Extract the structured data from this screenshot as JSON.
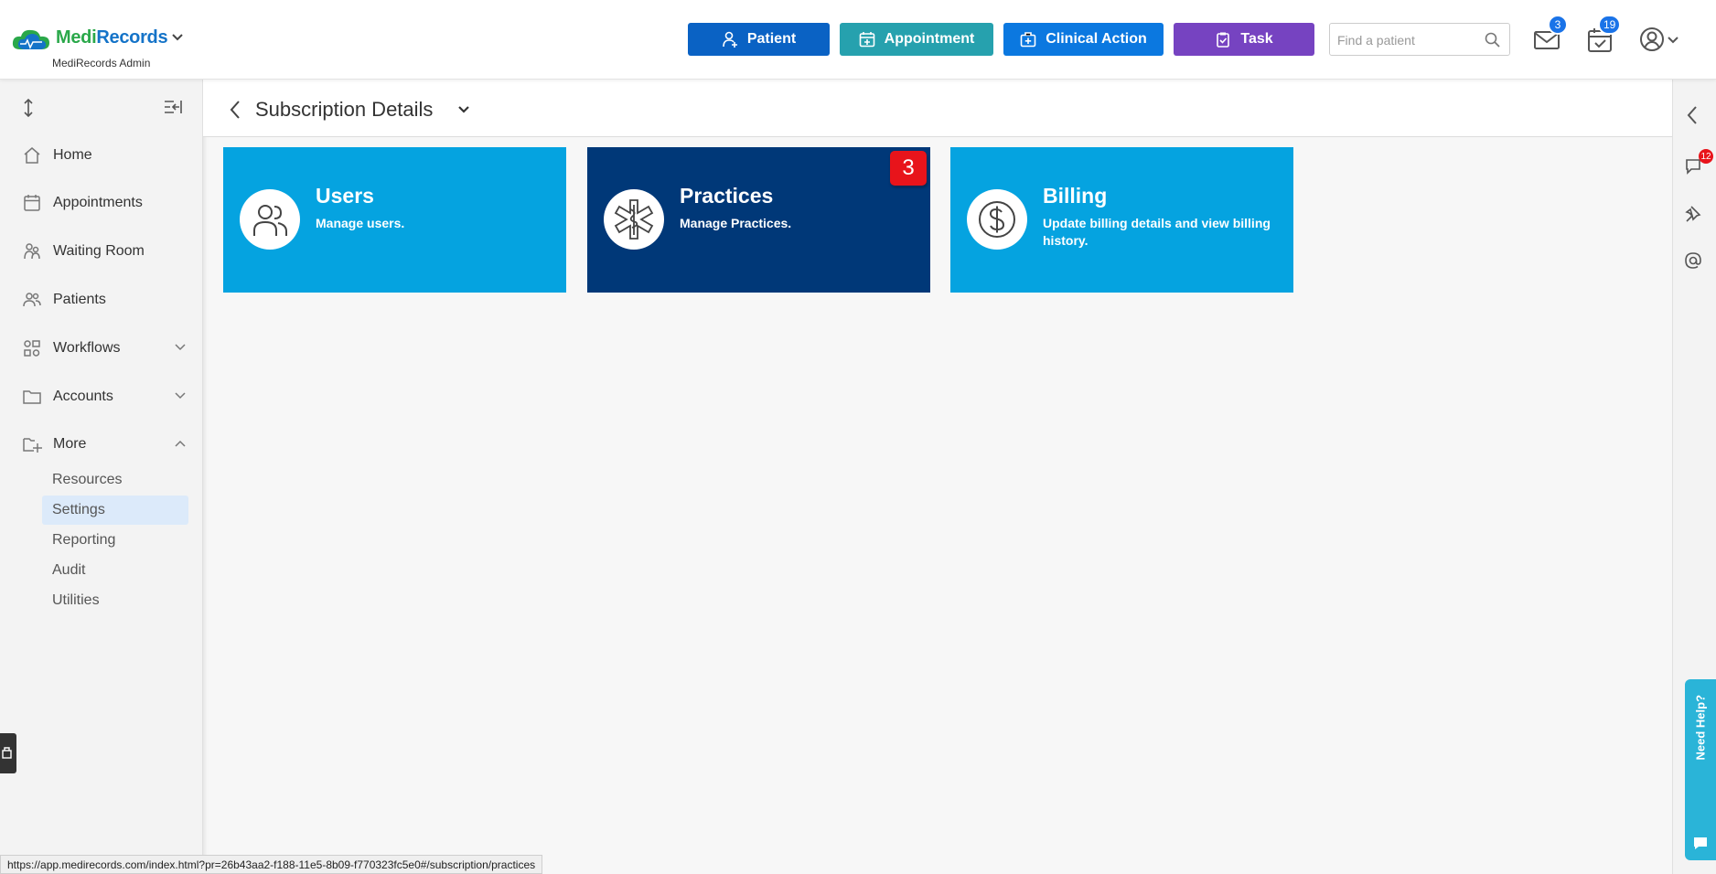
{
  "header": {
    "logo": {
      "part1": "Medi",
      "part2": "Records",
      "subtitle": "MediRecords Admin"
    },
    "buttons": [
      {
        "label": "Patient",
        "color": "#0a62c4",
        "icon": "add-person-icon"
      },
      {
        "label": "Appointment",
        "color": "#26a1ae",
        "icon": "calendar-plus-icon"
      },
      {
        "label": "Clinical Action",
        "color": "#0b78e0",
        "icon": "medical-kit-icon"
      },
      {
        "label": "Task",
        "color": "#7643c1",
        "icon": "clipboard-check-icon"
      }
    ],
    "search": {
      "placeholder": "Find a patient",
      "value": ""
    },
    "mail_badge": "3",
    "calendar_badge": "19"
  },
  "sidebar": {
    "items": [
      {
        "label": "Home",
        "icon": "home-icon"
      },
      {
        "label": "Appointments",
        "icon": "calendar-icon"
      },
      {
        "label": "Waiting Room",
        "icon": "waiting-room-icon"
      },
      {
        "label": "Patients",
        "icon": "people-icon"
      },
      {
        "label": "Workflows",
        "icon": "workflow-icon"
      },
      {
        "label": "Accounts",
        "icon": "folder-icon"
      },
      {
        "label": "More",
        "icon": "folder-plus-icon"
      }
    ],
    "more_sub": [
      "Resources",
      "Settings",
      "Reporting",
      "Audit",
      "Utilities"
    ],
    "active_sub": "Settings"
  },
  "page": {
    "title": "Subscription Details"
  },
  "cards": [
    {
      "title": "Users",
      "description": "Manage users.",
      "color": "#05a3e0",
      "icon": "users-icon"
    },
    {
      "title": "Practices",
      "description": "Manage Practices.",
      "color": "#003878",
      "icon": "star-of-life-icon",
      "badge": "3"
    },
    {
      "title": "Billing",
      "description": "Update billing details and view billing history.",
      "color": "#05a3e0",
      "icon": "dollar-icon"
    }
  ],
  "rail": {
    "chat_badge": "12",
    "help_label": "Need Help?"
  },
  "statusbar": {
    "url": "https://app.medirecords.com/index.html?pr=26b43aa2-f188-11e5-8b09-f770323fc5e0#/subscription/practices"
  }
}
